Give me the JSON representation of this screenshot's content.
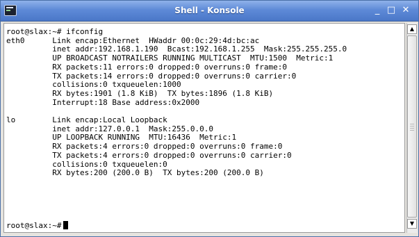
{
  "window": {
    "title": "Shell - Konsole",
    "controls": {
      "minimize": "_",
      "maximize": "□",
      "close": "✕"
    },
    "icon": "terminal-icon"
  },
  "terminal": {
    "output": "root@slax:~# ifconfig\neth0      Link encap:Ethernet  HWaddr 00:0c:29:4d:bc:ac\n          inet addr:192.168.1.190  Bcast:192.168.1.255  Mask:255.255.255.0\n          UP BROADCAST NOTRAILERS RUNNING MULTICAST  MTU:1500  Metric:1\n          RX packets:11 errors:0 dropped:0 overruns:0 frame:0\n          TX packets:14 errors:0 dropped:0 overruns:0 carrier:0\n          collisions:0 txqueuelen:1000\n          RX bytes:1901 (1.8 KiB)  TX bytes:1896 (1.8 KiB)\n          Interrupt:18 Base address:0x2000\n\nlo        Link encap:Local Loopback\n          inet addr:127.0.0.1  Mask:255.0.0.0\n          UP LOOPBACK RUNNING  MTU:16436  Metric:1\n          RX packets:4 errors:0 dropped:0 overruns:0 frame:0\n          TX packets:4 errors:0 dropped:0 overruns:0 carrier:0\n          collisions:0 txqueuelen:0\n          RX bytes:200 (200.0 B)  TX bytes:200 (200.0 B)",
    "prompt": "root@slax:~#"
  },
  "colors": {
    "titlebar": "#5e8ad7",
    "terminal_bg": "#ffffff",
    "text": "#000000"
  },
  "scrollbar": {
    "up_arrow": "▲",
    "down_arrow": "▼"
  }
}
